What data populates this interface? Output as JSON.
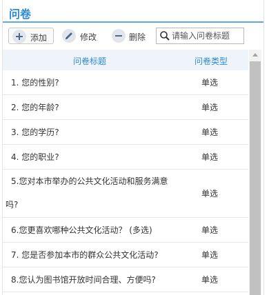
{
  "panel": {
    "title": "问卷"
  },
  "toolbar": {
    "add_label": "添加",
    "edit_label": "修改",
    "delete_label": "删除",
    "search_placeholder": "请输入问卷标题"
  },
  "table": {
    "columns": [
      "问卷标题",
      "问卷类型"
    ],
    "rows": [
      {
        "title": "1. 您的性别?",
        "type": "单选"
      },
      {
        "title": "2. 您的年龄?",
        "type": "单选"
      },
      {
        "title": "3. 您的学历?",
        "type": "单选"
      },
      {
        "title": "4. 您的职业?",
        "type": "单选"
      },
      {
        "title": "5.您对本市举办的公共文化活动和服务满意吗?",
        "type": "单选"
      },
      {
        "title": "6.您更喜欢哪种公共文化活动？ (多选)",
        "type": "单选"
      },
      {
        "title": "7. 您是否参加本市的群众公共文化活动?",
        "type": "单选"
      },
      {
        "title": "8.您认为图书馆开放时间合理、方便吗?",
        "type": "单选"
      }
    ]
  },
  "icons": {
    "add": "plus-icon",
    "edit": "pencil-icon",
    "delete": "minus-icon",
    "search": "search-icon"
  }
}
